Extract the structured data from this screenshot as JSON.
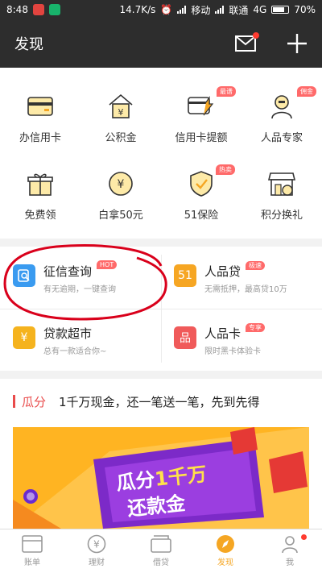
{
  "status_bar": {
    "time": "8:48",
    "net_speed": "14.7K/s",
    "carrier1": "移动",
    "carrier2": "联通",
    "network": "4G",
    "battery": "70%"
  },
  "header": {
    "title": "发现"
  },
  "grid": [
    {
      "label": "办信用卡",
      "icon": "credit-card-icon",
      "tag": ""
    },
    {
      "label": "公积金",
      "icon": "house-fund-icon",
      "tag": ""
    },
    {
      "label": "信用卡提额",
      "icon": "card-upgrade-icon",
      "tag": "最谱"
    },
    {
      "label": "人品专家",
      "icon": "expert-icon",
      "tag": "佣金"
    },
    {
      "label": "免费领",
      "icon": "gift-icon",
      "tag": ""
    },
    {
      "label": "白拿50元",
      "icon": "coin-icon",
      "tag": ""
    },
    {
      "label": "51保险",
      "icon": "shield-icon",
      "tag": "热卖"
    },
    {
      "label": "积分换礼",
      "icon": "shop-icon",
      "tag": ""
    }
  ],
  "features": [
    {
      "title": "征信查询",
      "tag": "HOT",
      "desc": "有无逾期，一键查询",
      "icon_text": "",
      "color": "#3a9bf0",
      "tag_color": "#ff6a6a"
    },
    {
      "title": "人品贷",
      "tag": "极速",
      "desc": "无需抵押，最高贷10万",
      "icon_text": "51",
      "color": "#f6a623",
      "tag_color": "#ff6a6a"
    },
    {
      "title": "贷款超市",
      "tag": "",
      "desc": "总有一款适合你~",
      "icon_text": "¥",
      "color": "#f5b31e",
      "tag_color": ""
    },
    {
      "title": "人品卡",
      "tag": "专享",
      "desc": "限时黑卡体验卡",
      "icon_text": "品",
      "color": "#f05a5a",
      "tag_color": "#ff6a6a"
    }
  ],
  "promo": {
    "key": "瓜分",
    "text": "1千万现金，还一笔送一笔，先到先得",
    "banner_line1": "瓜分",
    "banner_amount": "1千万",
    "banner_line2": "还款金"
  },
  "bottom_nav": [
    {
      "label": "账单",
      "icon": "bill-icon",
      "active": false
    },
    {
      "label": "理财",
      "icon": "yen-icon",
      "active": false
    },
    {
      "label": "借贷",
      "icon": "loan-icon",
      "active": false
    },
    {
      "label": "发现",
      "icon": "compass-icon",
      "active": true
    },
    {
      "label": "我",
      "icon": "user-icon",
      "active": false
    }
  ],
  "colors": {
    "accent": "#f5a623",
    "header_bg": "#2d2d2d",
    "annotation": "#d9001b"
  }
}
